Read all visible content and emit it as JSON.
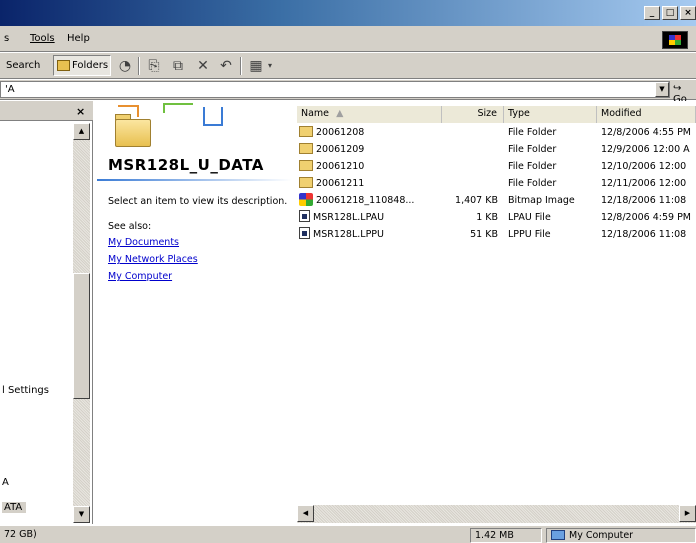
{
  "window": {
    "minimize": "_",
    "maximize": "□",
    "close": "×"
  },
  "menu": [
    "s",
    "Tools",
    "Help"
  ],
  "toolbar": {
    "search_label": "Search",
    "folders_label": "Folders"
  },
  "address": {
    "value": "'A",
    "go_label": "Go"
  },
  "folders_pane": {
    "close": "×",
    "tree_items": [
      {
        "label": "l Settings"
      },
      {
        "label": "A"
      },
      {
        "label": "ATA"
      }
    ]
  },
  "task_pane": {
    "title": "MSR128L_U_DATA",
    "description": "Select an item to view its description.",
    "see_also": "See also:",
    "links": [
      "My Documents",
      "My Network Places",
      "My Computer"
    ]
  },
  "list": {
    "columns": [
      "Name",
      "Size",
      "Type",
      "Modified"
    ],
    "rows": [
      {
        "icon": "folder-icon",
        "name": "20061208",
        "size": "",
        "type": "File Folder",
        "modified": "12/8/2006 4:55 PM"
      },
      {
        "icon": "folder-icon",
        "name": "20061209",
        "size": "",
        "type": "File Folder",
        "modified": "12/9/2006 12:00 A"
      },
      {
        "icon": "folder-icon",
        "name": "20061210",
        "size": "",
        "type": "File Folder",
        "modified": "12/10/2006 12:00"
      },
      {
        "icon": "folder-icon",
        "name": "20061211",
        "size": "",
        "type": "File Folder",
        "modified": "12/11/2006 12:00"
      },
      {
        "icon": "bitmap-icon",
        "name": "20061218_110848...",
        "size": "1,407 KB",
        "type": "Bitmap Image",
        "modified": "12/18/2006 11:08"
      },
      {
        "icon": "document-icon",
        "name": "MSR128L.LPAU",
        "size": "1 KB",
        "type": "LPAU File",
        "modified": "12/8/2006 4:59 PM"
      },
      {
        "icon": "document-icon",
        "name": "MSR128L.LPPU",
        "size": "51 KB",
        "type": "LPPU File",
        "modified": "12/18/2006 11:08"
      }
    ]
  },
  "status": {
    "left": "72 GB)",
    "size": "1.42 MB",
    "zone": "My Computer"
  }
}
